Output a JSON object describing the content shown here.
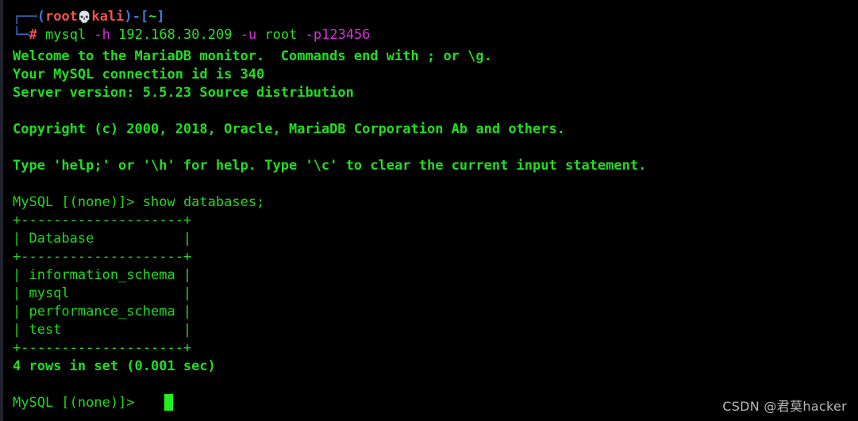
{
  "terminal": {
    "background_color": "#000000",
    "edge_strip_color": "#20222e",
    "default_text_color": "#1fd91f",
    "cursor_color": "#22ee22",
    "prompt": {
      "branch_top": "┌──",
      "branch_bottom": "└─",
      "paren_open": "(",
      "user": "root",
      "skull_icon": "💀",
      "host": "kali",
      "paren_close": ")",
      "dash": "-",
      "bracket_open": "[",
      "path": "~",
      "bracket_close": "]",
      "hash": "#"
    },
    "command": {
      "program": "mysql",
      "flag_h": "-h",
      "host_ip": "192.168.30.209",
      "flag_u": "-u",
      "user": "root",
      "flag_p": "-p123456"
    },
    "output": {
      "welcome": "Welcome to the MariaDB monitor.  Commands end with ; or \\g.",
      "connection_id": "Your MySQL connection id is 340",
      "server_version": "Server version: 5.5.23 Source distribution",
      "copyright": "Copyright (c) 2000, 2018, Oracle, MariaDB Corporation Ab and others.",
      "help_hint": "Type 'help;' or '\\h' for help. Type '\\c' to clear the current input statement."
    },
    "query": {
      "prompt_label": "MySQL [(none)]>",
      "sql": " show databases;",
      "table": {
        "border": "+--------------------+",
        "header_row": "| Database           |",
        "rows": [
          "| information_schema |",
          "| mysql              |",
          "| performance_schema |",
          "| test               |"
        ]
      },
      "result_summary": "4 rows in set (0.001 sec)"
    },
    "final_prompt": {
      "label": "MySQL [(none)]>"
    }
  },
  "watermark": {
    "text": "CSDN @君莫hacker"
  }
}
